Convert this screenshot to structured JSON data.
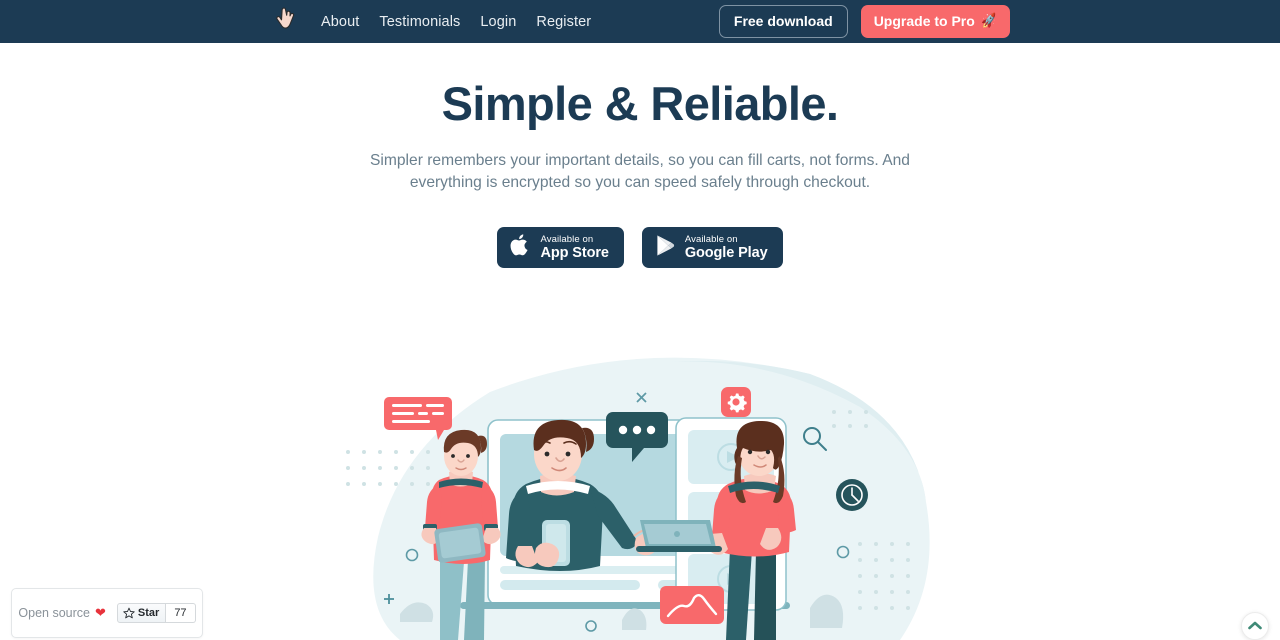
{
  "navbar": {
    "logo_icon": "pointing-hand-icon",
    "links": [
      {
        "label": "About"
      },
      {
        "label": "Testimonials"
      },
      {
        "label": "Login"
      },
      {
        "label": "Register"
      }
    ],
    "free_download_label": "Free download",
    "upgrade_label": "Upgrade to Pro",
    "upgrade_icon": "rocket-icon",
    "background_color": "#1c3b54",
    "accent_color": "#f8696b"
  },
  "hero": {
    "title": "Simple & Reliable.",
    "subtitle": "Simpler remembers your important details, so you can fill carts, not forms. And everything is encrypted so you can speed safely through checkout.",
    "title_color": "#1c3b54",
    "subtitle_color": "#6a7f8d"
  },
  "store_badges": [
    {
      "icon": "apple-icon",
      "small_text": "Available on",
      "big_text": "App Store"
    },
    {
      "icon": "google-play-icon",
      "small_text": "Available on",
      "big_text": "Google Play"
    }
  ],
  "illustration": {
    "alt_name": "team-collaboration-illustration",
    "blob_color": "#eaf4f6",
    "red": "#f8696b",
    "teal": "#2c6069",
    "light_blue": "#c8e0e6",
    "elements": [
      "speech-bubble-red",
      "chat-dots-bubble",
      "gear-badge",
      "clock-badge",
      "search-icon",
      "close-icon",
      "plus-icon",
      "chart-card",
      "browser-window",
      "person-left",
      "person-center",
      "person-right"
    ]
  },
  "github_widget": {
    "open_source_label": "Open source",
    "heart_icon": "heart-icon",
    "heart_color": "#e8333c",
    "star_icon": "star-icon",
    "star_label": "Star",
    "star_count": "77"
  },
  "scroll_top": {
    "icon": "chevron-up-icon",
    "color": "#3f8a77"
  }
}
